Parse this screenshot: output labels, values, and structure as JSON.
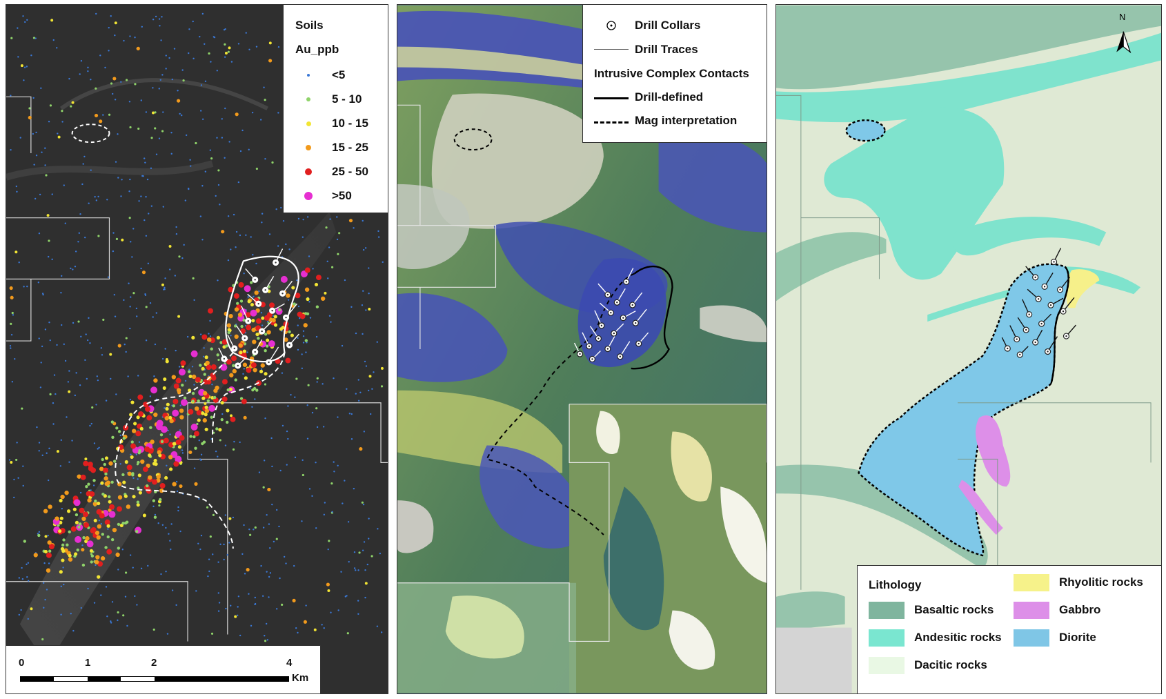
{
  "soils_legend": {
    "title": "Soils",
    "subtitle": "Au_ppb",
    "classes": [
      {
        "label": "<5",
        "color": "#3a78d6"
      },
      {
        "label": "5 - 10",
        "color": "#8fd36a"
      },
      {
        "label": "10 - 15",
        "color": "#f2e534"
      },
      {
        "label": "15 - 25",
        "color": "#f29a1c"
      },
      {
        "label": "25 - 50",
        "color": "#e11f1f"
      },
      {
        "label": ">50",
        "color": "#e62fd1"
      }
    ]
  },
  "scale_bar": {
    "ticks": [
      "0",
      "1",
      "2",
      "4"
    ],
    "unit": "Km"
  },
  "drill_legend": {
    "collars": "Drill Collars",
    "traces": "Drill Traces",
    "contacts_title": "Intrusive Complex Contacts",
    "drill_defined": "Drill-defined",
    "mag": "Mag interpretation"
  },
  "lithology_legend": {
    "title": "Lithology",
    "items": [
      {
        "label": "Basaltic rocks",
        "color": "#7fb59e"
      },
      {
        "label": "Andesitic rocks",
        "color": "#7ae6d0"
      },
      {
        "label": "Dacitic rocks",
        "color": "#e9f8e4"
      },
      {
        "label": "Rhyolitic rocks",
        "color": "#f6f28a"
      },
      {
        "label": "Gabbro",
        "color": "#dd8fe8"
      },
      {
        "label": "Diorite",
        "color": "#7fc6e6"
      }
    ]
  },
  "north_arrow": {
    "label": "N"
  }
}
